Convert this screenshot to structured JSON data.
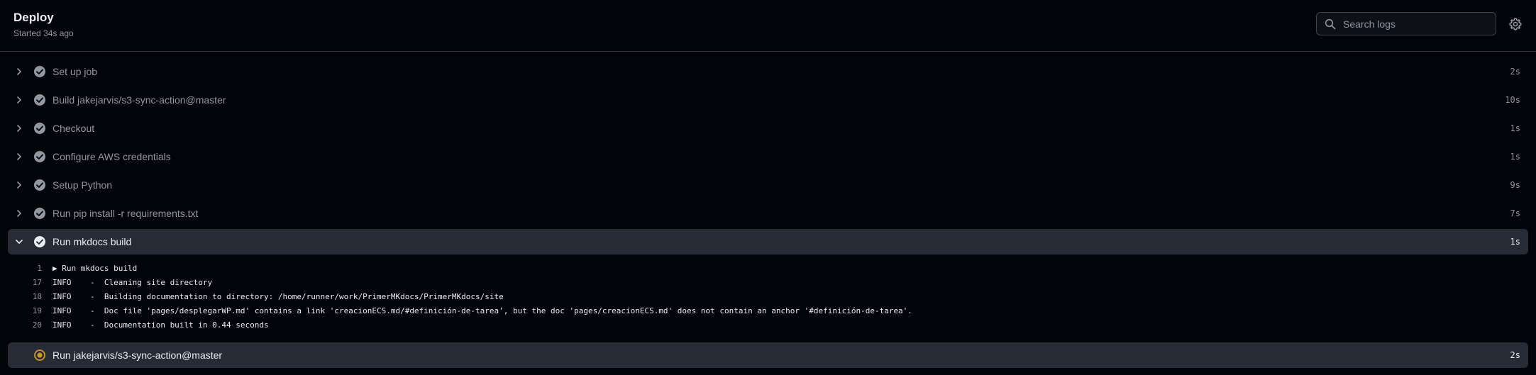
{
  "job": {
    "title": "Deploy",
    "subtitle": "Started 34s ago"
  },
  "search": {
    "placeholder": "Search logs",
    "value": ""
  },
  "icons": {
    "search": "search-icon",
    "settings": "gear-icon",
    "success": "check-circle-icon",
    "in_progress": "spinner-icon",
    "collapsed": "chevron-right-icon",
    "expanded": "chevron-down-icon"
  },
  "colors": {
    "background": "#010409",
    "active_row": "#262c36",
    "success": "#9198a1",
    "in_progress": "#d29922"
  },
  "steps": [
    {
      "label": "Set up job",
      "time": "2s",
      "status": "success",
      "expanded": false
    },
    {
      "label": "Build jakejarvis/s3-sync-action@master",
      "time": "10s",
      "status": "success",
      "expanded": false
    },
    {
      "label": "Checkout",
      "time": "1s",
      "status": "success",
      "expanded": false
    },
    {
      "label": "Configure AWS credentials",
      "time": "1s",
      "status": "success",
      "expanded": false
    },
    {
      "label": "Setup Python",
      "time": "9s",
      "status": "success",
      "expanded": false
    },
    {
      "label": "Run pip install -r requirements.txt",
      "time": "7s",
      "status": "success",
      "expanded": false
    },
    {
      "label": "Run mkdocs build",
      "time": "1s",
      "status": "success",
      "expanded": true
    },
    {
      "label": "Run jakejarvis/s3-sync-action@master",
      "time": "2s",
      "status": "in_progress",
      "expanded": false
    }
  ],
  "log": [
    {
      "num": "1",
      "text": "▶ Run mkdocs build"
    },
    {
      "num": "17",
      "text": "INFO    -  Cleaning site directory"
    },
    {
      "num": "18",
      "text": "INFO    -  Building documentation to directory: /home/runner/work/PrimerMKdocs/PrimerMKdocs/site"
    },
    {
      "num": "19",
      "text": "INFO    -  Doc file 'pages/desplegarWP.md' contains a link 'creacionECS.md/#definición-de-tarea', but the doc 'pages/creacionECS.md' does not contain an anchor '#definición-de-tarea'."
    },
    {
      "num": "20",
      "text": "INFO    -  Documentation built in 0.44 seconds"
    }
  ]
}
